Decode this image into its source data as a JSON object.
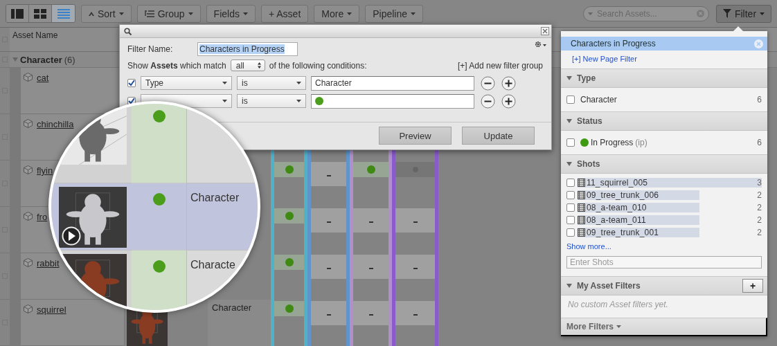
{
  "toolbar": {
    "view_buttons": [
      {
        "kind": "panels",
        "selected": false
      },
      {
        "kind": "grid",
        "selected": false
      },
      {
        "kind": "list",
        "selected": true
      }
    ],
    "buttons": [
      {
        "label": "Sort",
        "kind": "sort",
        "menu": true
      },
      {
        "label": "Group",
        "kind": "group",
        "menu": true
      },
      {
        "label": "Fields",
        "kind": "plain",
        "menu": true
      },
      {
        "label": "+ Asset",
        "kind": "plain",
        "menu": false
      },
      {
        "label": "More",
        "kind": "plain",
        "menu": true
      },
      {
        "label": "Pipeline",
        "kind": "plain",
        "menu": true
      }
    ],
    "search": {
      "placeholder": "Search Assets..."
    },
    "filter_button": {
      "label": "Filter",
      "active": true
    }
  },
  "table": {
    "header_checked": false,
    "columns": [
      {
        "label": "Asset Name"
      }
    ],
    "group": {
      "label": "Character",
      "count": "(6)",
      "expanded": true,
      "checked": false
    },
    "rows": [
      {
        "name": "cat",
        "checked": false
      },
      {
        "name": "chinchilla",
        "checked": false
      },
      {
        "name": "flyin",
        "checked": false,
        "steps": [
          {
            "kind": "status",
            "color": "#3f8a12"
          },
          {
            "kind": "empty"
          },
          {
            "kind": "status",
            "color": "#3f8a12"
          },
          {
            "kind": "dot",
            "color": "#666666"
          }
        ]
      },
      {
        "name": "fro",
        "checked": false,
        "steps": [
          {
            "kind": "status",
            "color": "#3f8a12"
          },
          {
            "kind": "empty"
          },
          {
            "kind": "empty"
          },
          {
            "kind": "empty"
          }
        ]
      },
      {
        "name": "rabbit",
        "checked": false,
        "steps": [
          {
            "kind": "status",
            "color": "#3f8a12"
          },
          {
            "kind": "empty"
          },
          {
            "kind": "empty"
          },
          {
            "kind": "empty"
          }
        ]
      },
      {
        "name": "squirrel",
        "checked": false,
        "thumbnail": {
          "kind": "picture"
        },
        "type": "Character",
        "steps": [
          {
            "kind": "status",
            "color": "#3f8a12"
          },
          {
            "kind": "empty"
          },
          {
            "kind": "empty"
          },
          {
            "kind": "empty"
          }
        ]
      }
    ]
  },
  "magnifier": {
    "rows": [
      {
        "thumbnail": {
          "kind": "picture"
        },
        "color": "#4a9e1c",
        "selected": false
      },
      {
        "thumbnail": {
          "kind": "picture"
        },
        "playable": true,
        "color": "#4a9e1c",
        "type": "Character",
        "selected": true
      },
      {
        "thumbnail": {
          "kind": "picture"
        },
        "color": "#4a9e1c",
        "type": "Characte",
        "selected": false
      }
    ]
  },
  "filter_dialog": {
    "name_label": "Filter Name:",
    "name_value": "Characters in Progress",
    "match_text": "Show **Assets** which match",
    "match_value": "all",
    "match_suffix": "of the following conditions:",
    "add_group_link": "[+] Add new filter group",
    "conditions": [
      {
        "checked": true,
        "field": "Type",
        "operator": "is",
        "value": "Character"
      },
      {
        "checked": true,
        "operator": "is",
        "color": "#4a9e1c"
      }
    ],
    "buttons": [
      "Preview",
      "Update"
    ]
  },
  "filter_panel": {
    "saved_filters": [
      {
        "label": "Characters in Progress",
        "selected": true
      }
    ],
    "new_filter_link": "[+] New Page Filter",
    "sections": [
      {
        "title": "Type",
        "expanded": true,
        "items": [
          {
            "kind": "plain",
            "label": "Character",
            "count": "6",
            "checked": false
          }
        ]
      },
      {
        "title": "Status",
        "expanded": true,
        "items": [
          {
            "kind": "status",
            "label": "In Progress",
            "code": "(ip)",
            "count": "6",
            "checked": false,
            "color": "#3f9a12"
          }
        ]
      },
      {
        "title": "Shots",
        "expanded": true,
        "items": [
          {
            "kind": "shot",
            "label": "11_squirrel_005",
            "count": "3",
            "checked": false,
            "level": 1
          },
          {
            "kind": "shot",
            "label": "09_tree_trunk_006",
            "count": "2",
            "checked": false,
            "level": 0.66
          },
          {
            "kind": "shot",
            "label": "08_a-team_010",
            "count": "2",
            "checked": false,
            "level": 0.66
          },
          {
            "kind": "shot",
            "label": "08_a-team_011",
            "count": "2",
            "checked": false,
            "level": 0.66
          },
          {
            "kind": "shot",
            "label": "09_tree_trunk_001",
            "count": "2",
            "checked": false,
            "level": 0.66
          }
        ],
        "show_more": "Show more...",
        "input_placeholder": "Enter Shots"
      },
      {
        "title": "My Asset Filters",
        "expanded": true,
        "add_button": "+",
        "empty_text": "No custom Asset filters yet."
      }
    ],
    "more_filters": "More Filters"
  }
}
